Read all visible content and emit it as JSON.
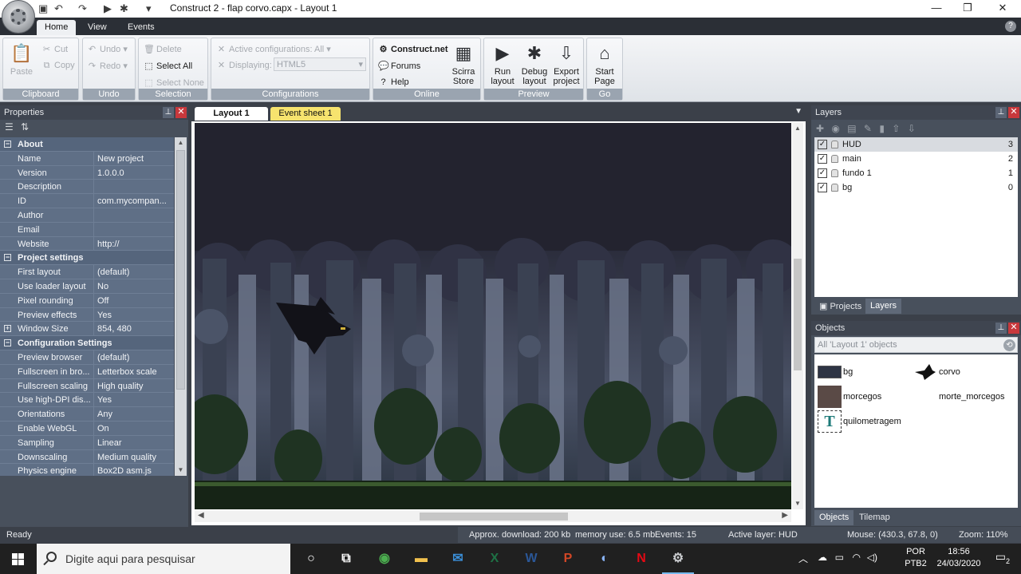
{
  "window": {
    "title": "Construct 2 - flap corvo.capx - Layout 1",
    "minimize": "—",
    "maximize": "❐",
    "close": "✕"
  },
  "ribbon": {
    "tabs": [
      "Home",
      "View",
      "Events"
    ],
    "clipboard": {
      "label": "Clipboard",
      "paste": "Paste",
      "cut": "Cut",
      "copy": "Copy"
    },
    "undo": {
      "label": "Undo",
      "undo": "Undo",
      "redo": "Redo"
    },
    "selection": {
      "label": "Selection",
      "delete": "Delete",
      "select_all": "Select All",
      "select_none": "Select None"
    },
    "configurations": {
      "label": "Configurations",
      "active": "Active configurations: All",
      "displaying": "Displaying:",
      "displaying_value": "HTML5"
    },
    "online": {
      "label": "Online",
      "construct_net": "Construct.net",
      "forums": "Forums",
      "help": "Help",
      "store_line1": "Scirra",
      "store_line2": "Store"
    },
    "preview": {
      "label": "Preview",
      "run_line1": "Run",
      "run_line2": "layout",
      "debug_line1": "Debug",
      "debug_line2": "layout",
      "export_line1": "Export",
      "export_line2": "project"
    },
    "go": {
      "label": "Go",
      "start_line1": "Start",
      "start_line2": "Page"
    }
  },
  "properties": {
    "title": "Properties",
    "rows": [
      {
        "type": "cat",
        "name": "About",
        "exp": "−"
      },
      {
        "name": "Name",
        "value": "New project"
      },
      {
        "name": "Version",
        "value": "1.0.0.0"
      },
      {
        "name": "Description",
        "value": ""
      },
      {
        "name": "ID",
        "value": "com.mycompan..."
      },
      {
        "name": "Author",
        "value": ""
      },
      {
        "name": "Email",
        "value": ""
      },
      {
        "name": "Website",
        "value": "http://"
      },
      {
        "type": "cat",
        "name": "Project settings",
        "exp": "−"
      },
      {
        "name": "First layout",
        "value": "(default)"
      },
      {
        "name": "Use loader layout",
        "value": "No"
      },
      {
        "name": "Pixel rounding",
        "value": "Off"
      },
      {
        "name": "Preview effects",
        "value": "Yes"
      },
      {
        "name": "Window Size",
        "value": "854, 480",
        "exp": "+"
      },
      {
        "type": "cat",
        "name": "Configuration Settings",
        "exp": "−"
      },
      {
        "name": "Preview browser",
        "value": "(default)"
      },
      {
        "name": "Fullscreen in bro...",
        "value": "Letterbox scale"
      },
      {
        "name": "Fullscreen scaling",
        "value": "High quality"
      },
      {
        "name": "Use high-DPI dis...",
        "value": "Yes"
      },
      {
        "name": "Orientations",
        "value": "Any"
      },
      {
        "name": "Enable WebGL",
        "value": "On"
      },
      {
        "name": "Sampling",
        "value": "Linear"
      },
      {
        "name": "Downscaling",
        "value": "Medium quality"
      },
      {
        "name": "Physics engine",
        "value": "Box2D asm.js"
      }
    ]
  },
  "doc_tabs": {
    "layout": "Layout 1",
    "events": "Event sheet 1"
  },
  "layers": {
    "title": "Layers",
    "items": [
      {
        "name": "HUD",
        "index": "3",
        "selected": true
      },
      {
        "name": "main",
        "index": "2"
      },
      {
        "name": "fundo 1",
        "index": "1"
      },
      {
        "name": "bg",
        "index": "0"
      }
    ],
    "tab_projects": "Projects",
    "tab_layers": "Layers"
  },
  "objects": {
    "title": "Objects",
    "filter_placeholder": "All 'Layout 1' objects",
    "items": [
      "bg",
      "corvo",
      "morcegos",
      "morte_morcegos",
      "quilometragem"
    ],
    "tab_objects": "Objects",
    "tab_tilemap": "Tilemap"
  },
  "status": {
    "ready": "Ready",
    "download": "Approx. download: 200 kb",
    "memory": "memory use: 6.5 mb",
    "events": "Events: 15",
    "active_layer": "Active layer: HUD",
    "mouse": "Mouse: (430.3, 67.8, 0)",
    "zoom": "Zoom: 110%"
  },
  "taskbar": {
    "search_placeholder": "Digite aqui para pesquisar",
    "lang_line1": "POR",
    "lang_line2": "PTB2",
    "time": "18:56",
    "date": "24/03/2020",
    "notifications": "2"
  },
  "colors": {
    "panel_bg": "#48505c",
    "props_grid": "#5f6f86",
    "accent_event_tab": "#f7e36e",
    "canvas_sky": "#23232f",
    "forest_dark": "#1f3322"
  }
}
